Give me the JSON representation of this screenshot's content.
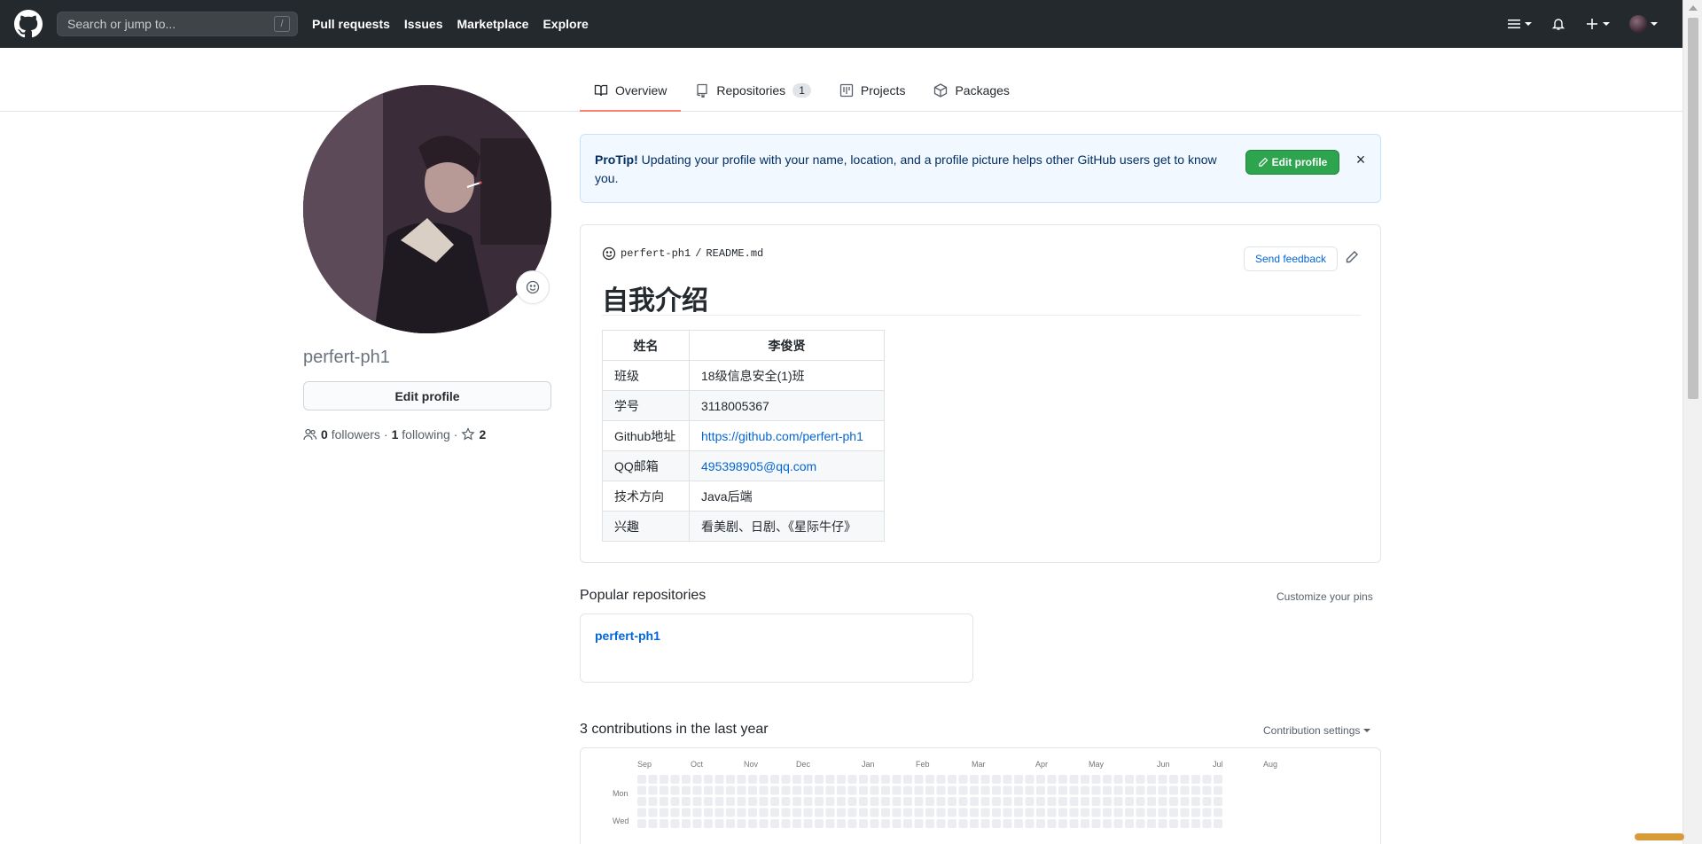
{
  "header": {
    "search_placeholder": "Search or jump to...",
    "search_shortcut": "/",
    "nav": [
      "Pull requests",
      "Issues",
      "Marketplace",
      "Explore"
    ]
  },
  "tabs": {
    "overview": "Overview",
    "repositories": "Repositories",
    "repositories_count": "1",
    "projects": "Projects",
    "packages": "Packages"
  },
  "profile": {
    "username": "perfert-ph1",
    "edit_button": "Edit profile",
    "followers_count": "0",
    "followers_label": "followers",
    "following_count": "1",
    "following_label": "following",
    "stars_count": "2"
  },
  "protip": {
    "title": "ProTip!",
    "text": "Updating your profile with your name, location, and a profile picture helps other GitHub users get to know you.",
    "button": "Edit profile"
  },
  "readme": {
    "path_user": "perfert-ph1",
    "path_sep": "/",
    "path_file": "README.md",
    "send_feedback": "Send feedback",
    "heading": "自我介绍",
    "table_headers": [
      "姓名",
      "李俊贤"
    ],
    "rows": [
      [
        "班级",
        "18级信息安全(1)班"
      ],
      [
        "学号",
        "3118005367"
      ],
      [
        "Github地址",
        "https://github.com/perfert-ph1"
      ],
      [
        "QQ邮箱",
        "495398905@qq.com"
      ],
      [
        "技术方向",
        "Java后端"
      ],
      [
        "兴趣",
        "看美剧、日剧、《星际牛仔》"
      ]
    ]
  },
  "popular": {
    "title": "Popular repositories",
    "customize": "Customize your pins",
    "repo_name": "perfert-ph1"
  },
  "contributions": {
    "title": "3 contributions in the last year",
    "settings": "Contribution settings",
    "months": [
      "Sep",
      "Oct",
      "Nov",
      "Dec",
      "Jan",
      "Feb",
      "Mar",
      "Apr",
      "May",
      "Jun",
      "Jul",
      "Aug"
    ],
    "day_labels": [
      "Mon",
      "Wed"
    ]
  },
  "colors": {
    "header_bg": "#24292e",
    "accent_green": "#2ea44f",
    "link_blue": "#0366d6",
    "tab_underline": "#f9826c"
  }
}
